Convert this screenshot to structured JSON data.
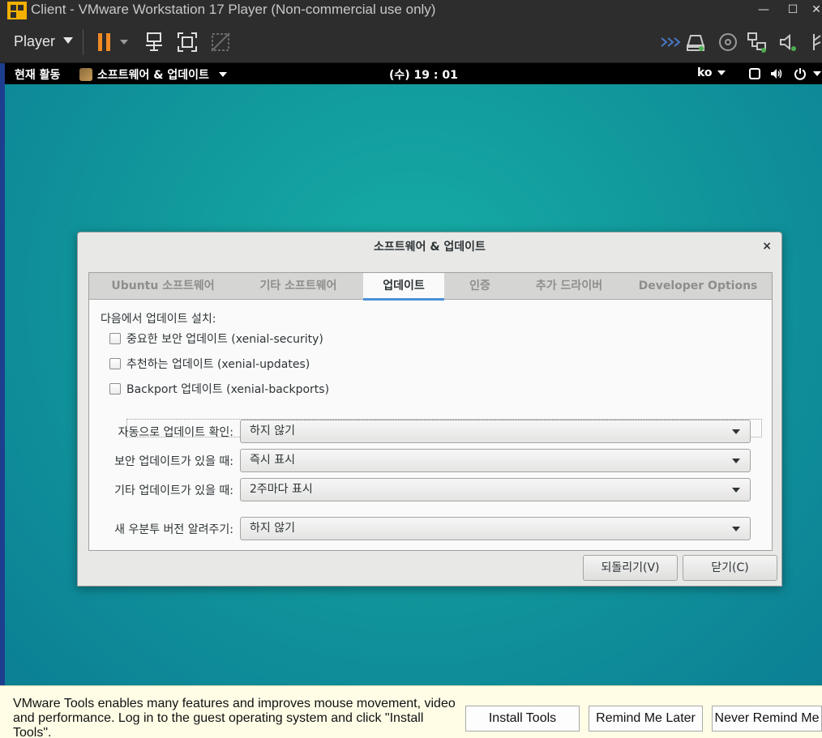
{
  "window": {
    "title": "Client - VMware Workstation 17 Player (Non-commercial use only)",
    "minimize": "—",
    "maximize": "☐",
    "close": "✕"
  },
  "toolbar": {
    "player_label": "Player",
    "icons": [
      "pause-icon",
      "send-ctrl-alt-del-icon",
      "fullscreen-icon",
      "unity-icon",
      "network-icon",
      "hard-disk-icon",
      "cd-icon",
      "network-adapter-icon",
      "sound-icon",
      "usb-icon"
    ]
  },
  "topbar": {
    "activities": "현재 활동",
    "app_menu": "소프트웨어 & 업데이트",
    "clock": "(수) 19 : 01",
    "lang": "ko"
  },
  "dialog": {
    "title": "소프트웨어 & 업데이트",
    "close": "×",
    "tabs": [
      {
        "label": "Ubuntu 소프트웨어",
        "active": false
      },
      {
        "label": "기타 소프트웨어",
        "active": false
      },
      {
        "label": "업데이트",
        "active": true
      },
      {
        "label": "인증",
        "active": false
      },
      {
        "label": "추가 드라이버",
        "active": false
      },
      {
        "label": "Developer Options",
        "active": false
      }
    ],
    "install_updates_from": "다음에서 업데이트 설치:",
    "checkboxes": [
      {
        "label": "중요한 보안 업데이트 (xenial-security)",
        "checked": false
      },
      {
        "label": "추천하는 업데이트 (xenial-updates)",
        "checked": false
      },
      {
        "label": "Backport 업데이트 (xenial-backports)",
        "checked": false
      }
    ],
    "settings": [
      {
        "label": "자동으로 업데이트 확인:",
        "value": "하지 않기"
      },
      {
        "label": "보안 업데이트가 있을 때:",
        "value": "즉시 표시"
      },
      {
        "label": "기타 업데이트가 있을 때:",
        "value": "2주마다 표시"
      },
      {
        "label": "새 우분투 버전 알려주기:",
        "value": "하지 않기"
      }
    ],
    "revert_button": "되돌리기(V)",
    "close_button": "닫기(C)"
  },
  "tools_bar": {
    "message": "VMware Tools enables many features and improves mouse movement, video and performance. Log in to the guest operating system and click \"Install Tools\".",
    "install": "Install Tools",
    "remind_later": "Remind Me Later",
    "never_remind": "Never Remind Me"
  },
  "colors": {
    "accent_tab": "#4a90d9",
    "pause_orange": "#f08a24",
    "desktop_teal": "#11999c"
  }
}
